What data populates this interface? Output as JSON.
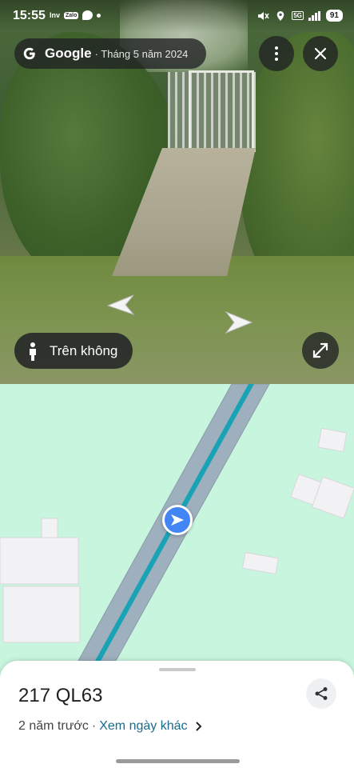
{
  "status_bar": {
    "time": "15:55",
    "app_tags": [
      "Inv",
      "Zalo"
    ],
    "battery": "91",
    "network": "5G"
  },
  "street_view": {
    "provider": "Google",
    "capture_date": "· Tháng 5 năm 2024",
    "aerial_label": "Trên không",
    "icons": {
      "more": "more-vert-icon",
      "close": "close-icon",
      "expand": "expand-icon",
      "person": "person-icon"
    }
  },
  "place": {
    "title": "217 QL63",
    "age": "2 năm trước",
    "separator": "·",
    "other_dates_link": "Xem ngày khác",
    "chevron": "›"
  },
  "colors": {
    "map_bg": "#c8f5dd",
    "road": "#9aabb9",
    "route": "#1aa3b7",
    "location": "#4285f4",
    "link": "#1a6b8a"
  }
}
